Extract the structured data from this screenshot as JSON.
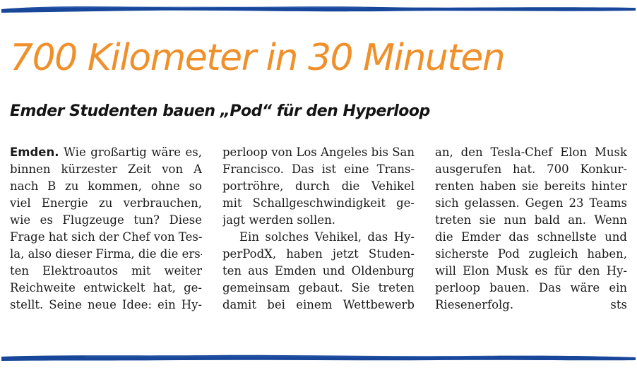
{
  "article": {
    "headline": "700 Kilometer in 30 Minuten",
    "subheadline": "Emder Studenten bauen „Pod“ für den Hyperloop",
    "dateline": "Emden.",
    "columns": [
      [
        "Wie großartig wäre es,",
        "binnen kürzester Zeit von A",
        "nach B zu kommen, ohne so",
        "viel Energie zu verbrauchen,",
        "wie es Flugzeuge tun? Diese",
        "Frage hat sich der Chef von Tes-",
        "la, also dieser Firma, die die ers-",
        "ten Elektroautos mit weiter",
        "Reichweite entwickelt hat, ge-",
        "stellt. Seine neue Idee: ein Hy-"
      ],
      [
        "perloop von Los Angeles bis San",
        "Francisco. Das ist eine Trans-",
        "portröhre, durch die Vehikel",
        "mit Schallgeschwindigkeit ge-",
        "jagt werden sollen.",
        "Ein solches Vehikel, das Hy-",
        "perPodX, haben jetzt Studen-",
        "ten aus Emden und Oldenburg",
        "gemeinsam gebaut. Sie treten",
        "damit bei einem Wettbewerb"
      ],
      [
        "an, den Tesla-Chef Elon Musk",
        "ausgerufen hat. 700 Konkur-",
        "renten haben sie bereits hinter",
        "sich gelassen. Gegen 23 Teams",
        "treten sie nun bald an. Wenn",
        "die Emder das schnellste und",
        "sicherste Pod zugleich haben,",
        "will Elon Musk es für den Hy-",
        "perloop bauen. Das wäre ein",
        "Riesenerfolg."
      ]
    ],
    "author": "sts"
  },
  "colors": {
    "headline": "#f0902a",
    "stroke": "#17469a",
    "text": "#1a1a1a"
  }
}
